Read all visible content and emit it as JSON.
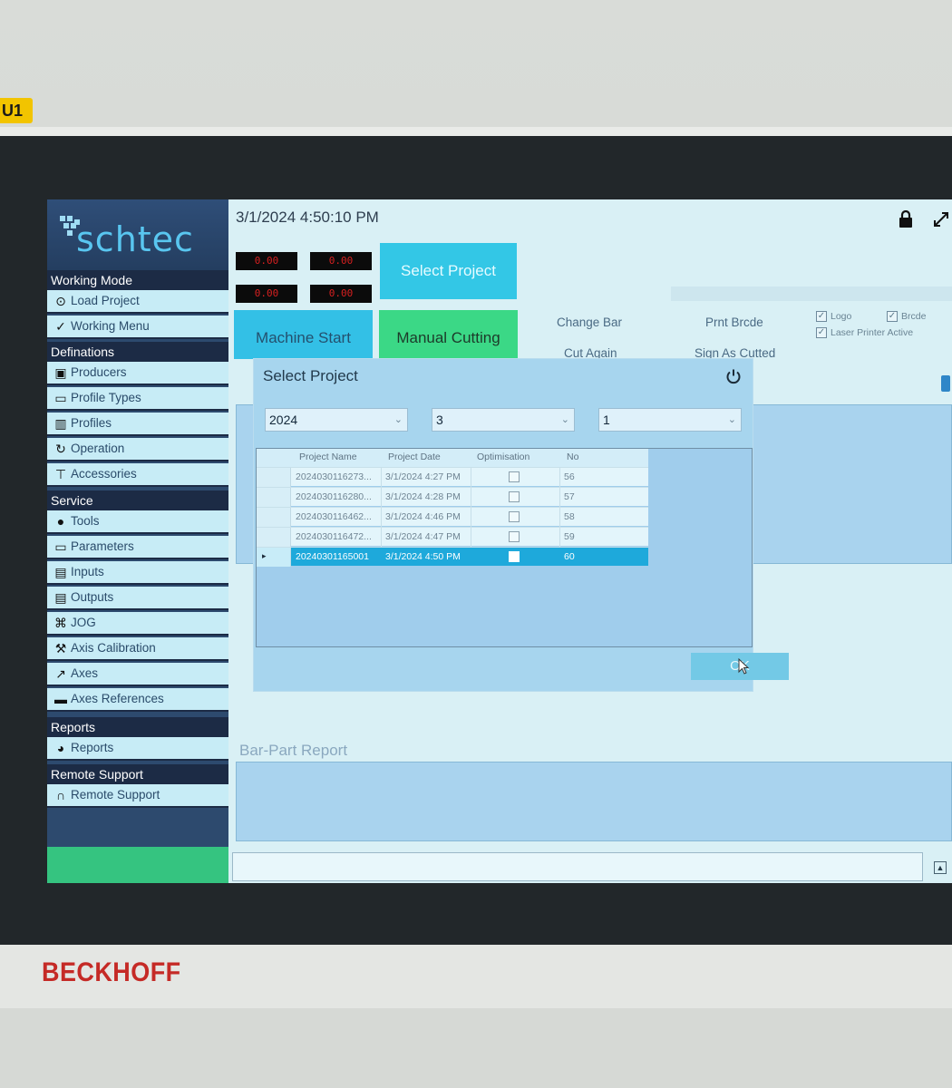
{
  "device": {
    "tag": "U1",
    "brand": "BECKHOFF"
  },
  "app": {
    "logo": "schtec",
    "datetime": "3/1/2024 4:50:10 PM"
  },
  "sidebar": {
    "sections": [
      {
        "title": "Working Mode",
        "items": [
          "Load Project",
          "Working Menu"
        ]
      },
      {
        "title": "Definations",
        "items": [
          "Producers",
          "Profile Types",
          "Profiles",
          "Operation",
          "Accessories"
        ]
      },
      {
        "title": "Service",
        "items": [
          "Tools",
          "Parameters",
          "Inputs",
          "Outputs",
          "JOG",
          "Axis Calibration",
          "Axes",
          "Axes References"
        ]
      },
      {
        "title": "Reports",
        "items": [
          "Reports"
        ]
      },
      {
        "title": "Remote Support",
        "items": [
          "Remote Support"
        ]
      }
    ]
  },
  "counters": [
    "0.00",
    "0.00",
    "0.00",
    "0.00"
  ],
  "buttons": {
    "select_project": "Select Project",
    "machine_start": "Machine Start",
    "manual_cutting": "Manual Cutting",
    "change_bar": "Change Bar",
    "cut_again": "Cut Again",
    "print_barcode": "Prnt Brcde",
    "sign_as_cutted": "Sign As Cutted"
  },
  "checkboxes": {
    "logo": {
      "label": "Logo",
      "checked": true
    },
    "barcode": {
      "label": "Brcde",
      "checked": true
    },
    "laser_printer": {
      "label": "Laser Printer Active",
      "checked": true
    }
  },
  "report": {
    "title": "Bar-Part Report"
  },
  "dialog": {
    "title": "Select Project",
    "filters": {
      "year": "2024",
      "month": "3",
      "day": "1"
    },
    "columns": [
      "Project Name",
      "Project Date",
      "Optimisation",
      "No"
    ],
    "rows": [
      {
        "name": "2024030116273...",
        "date": "3/1/2024 4:27 PM",
        "no": "56",
        "selected": false
      },
      {
        "name": "2024030116280...",
        "date": "3/1/2024 4:28 PM",
        "no": "57",
        "selected": false
      },
      {
        "name": "2024030116462...",
        "date": "3/1/2024 4:46 PM",
        "no": "58",
        "selected": false
      },
      {
        "name": "2024030116472...",
        "date": "3/1/2024 4:47 PM",
        "no": "59",
        "selected": false
      },
      {
        "name": "20240301165001",
        "date": "3/1/2024 4:50 PM",
        "no": "60",
        "selected": true
      }
    ],
    "ok_label": "OK"
  },
  "colors": {
    "sidebar_dark": "#1c2b45",
    "nav_item": "#c7ecf6",
    "accent_cyan": "#33c7e6",
    "accent_green": "#3bd886",
    "selected_row": "#1ea9db"
  },
  "icons": {
    "lock": "lock-icon",
    "expand": "expand-icon",
    "power": "power-icon",
    "load_project": "circle-arrow-icon",
    "working_menu": "check-circle-icon",
    "producers": "person-card-icon",
    "profile_types": "window-icon",
    "profiles": "profile-bars-icon",
    "operation": "rotate-icon",
    "accessories": "tool-icon",
    "tools": "gear-icon",
    "parameters": "window-icon",
    "inputs": "list-icon",
    "outputs": "list-icon",
    "jog": "gamepad-icon",
    "axis_calibration": "wrench-icon",
    "axes": "chart-line-icon",
    "axes_references": "ruler-icon",
    "reports": "pie-chart-icon",
    "remote_support": "headset-icon"
  }
}
